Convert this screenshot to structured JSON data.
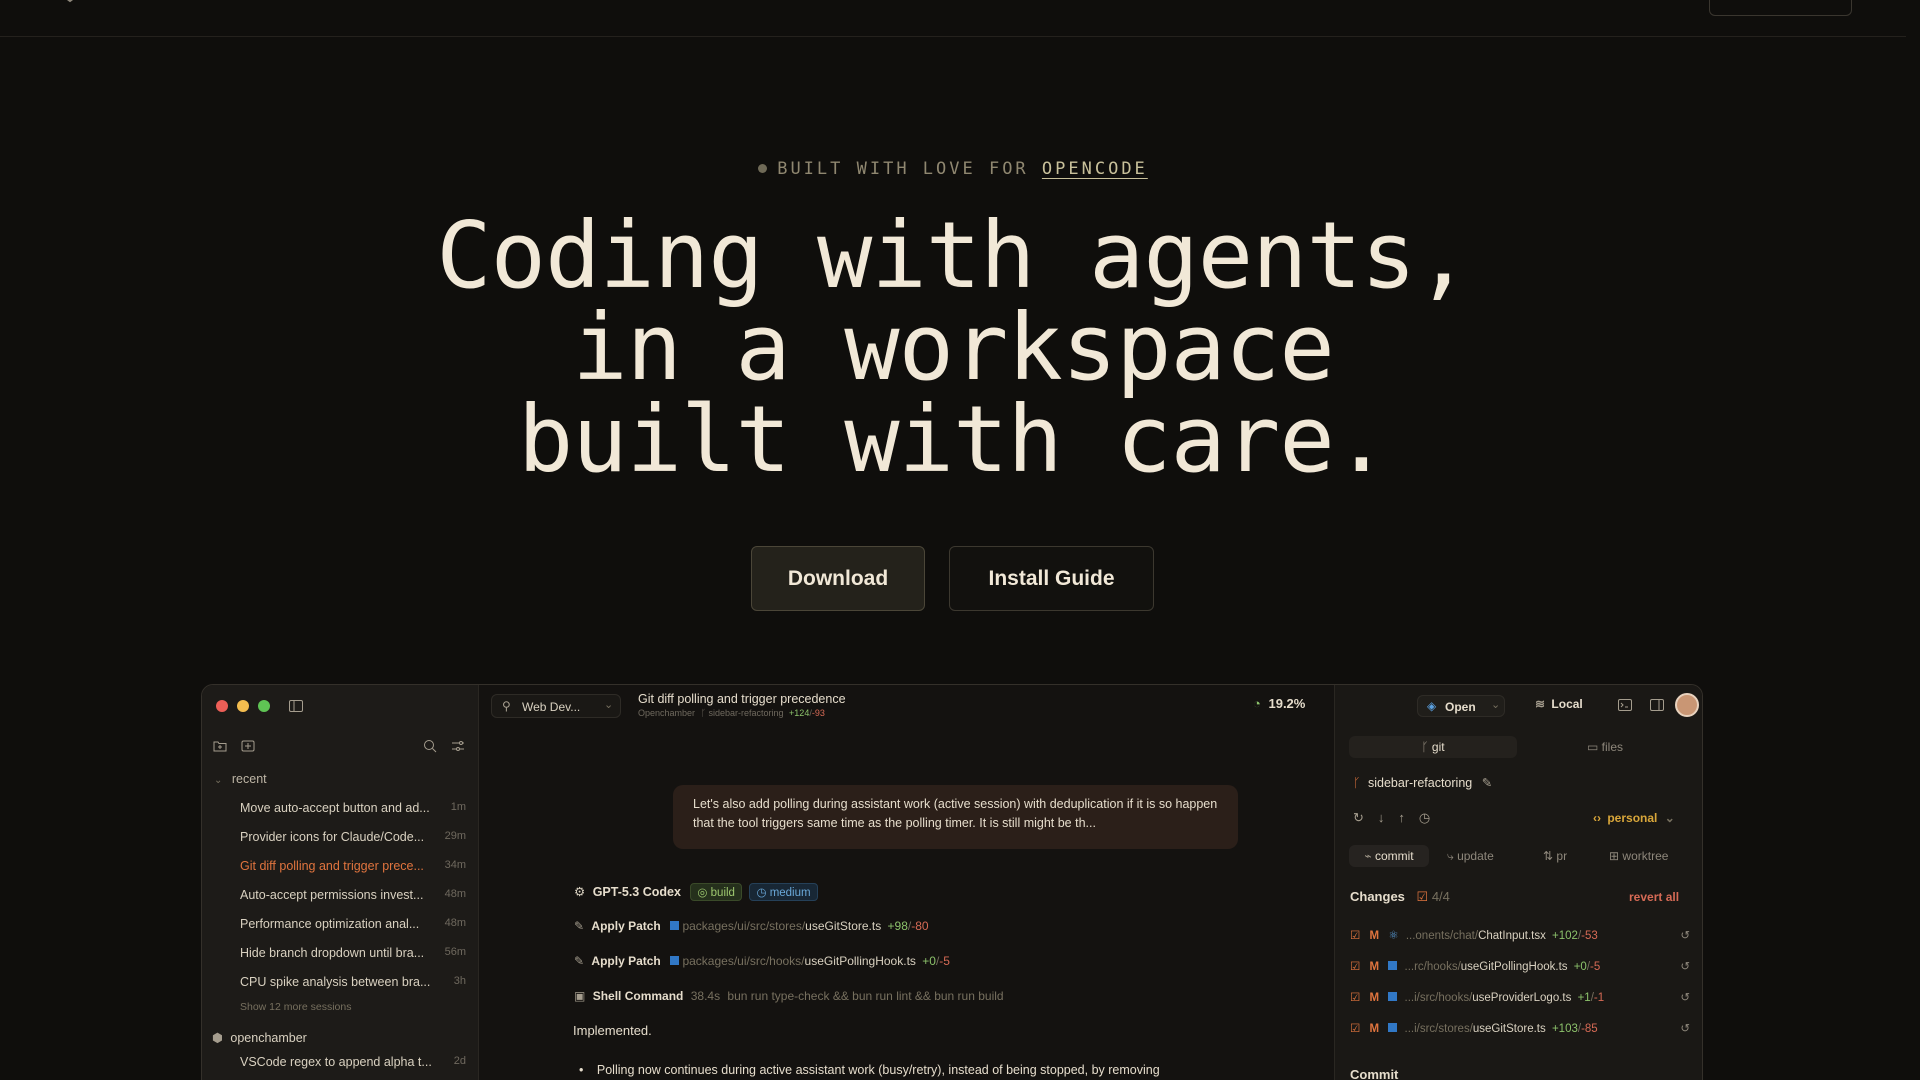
{
  "hero": {
    "eyebrow_prefix": "BUILT WITH LOVE FOR ",
    "eyebrow_link": "OPENCODE",
    "headline_line1": "Coding with agents,",
    "headline_line2": "in a workspace",
    "headline_line3": "built with care.",
    "download_label": "Download",
    "install_label": "Install Guide"
  },
  "app": {
    "sidebar": {
      "group_label": "recent",
      "sessions": [
        {
          "title": "Move auto-accept button and ad...",
          "ago": "1m"
        },
        {
          "title": "Provider icons for Claude/Code...",
          "ago": "29m"
        },
        {
          "title": "Git diff polling and trigger prece...",
          "ago": "34m"
        },
        {
          "title": "Auto-accept permissions invest...",
          "ago": "48m"
        },
        {
          "title": "Performance optimization anal...",
          "ago": "48m"
        },
        {
          "title": "Hide branch dropdown until bra...",
          "ago": "56m"
        },
        {
          "title": "CPU spike analysis between bra...",
          "ago": "3h"
        }
      ],
      "show_more": "Show 12 more sessions",
      "project_name": "openchamber",
      "project_session": {
        "title": "VSCode regex to append alpha t...",
        "ago": "2d"
      }
    },
    "header": {
      "project_selector": "Web Dev...",
      "session_title": "Git diff polling and trigger precedence",
      "session_project": "Openchamber",
      "session_branch": "sidebar-refactoring",
      "session_additions": "+124",
      "session_deletions": "-93",
      "context_percent": "19.2%"
    },
    "chat": {
      "user_message": "Let's also add polling during assistant work (active session) with deduplication if it is so happen that the tool triggers same time as the polling timer. It is still might be th...",
      "model_name": "GPT-5.3 Codex",
      "agent_badge": "build",
      "effort_badge": "medium",
      "tools": [
        {
          "name": "Apply Patch",
          "path_prefix": "packages/ui/src/stores/",
          "file": "useGitStore.ts",
          "add": "+98",
          "del": "-80"
        },
        {
          "name": "Apply Patch",
          "path_prefix": "packages/ui/src/hooks/",
          "file": "useGitPollingHook.ts",
          "add": "+0",
          "del": "-5"
        }
      ],
      "shell": {
        "name": "Shell Command",
        "duration": "38.4s",
        "command": "bun run type-check && bun run lint && bun run build"
      },
      "result": "Implemented.",
      "bullet": "Polling now continues during active assistant work (busy/retry), instead of being stopped, by removing"
    },
    "right": {
      "open_label": "Open",
      "local_label": "Local",
      "tab_git": "git",
      "tab_files": "files",
      "branch": "sidebar-refactoring",
      "identity": "personal",
      "actions": [
        "commit",
        "update",
        "pr",
        "worktree"
      ],
      "changes_label": "Changes",
      "changes_count": "4/4",
      "revert_all": "revert all",
      "files": [
        {
          "status": "M",
          "path": "...onents/chat/",
          "file": "ChatInput.tsx",
          "add": "+102",
          "del": "-53"
        },
        {
          "status": "M",
          "path": "...rc/hooks/",
          "file": "useGitPollingHook.ts",
          "add": "+0",
          "del": "-5"
        },
        {
          "status": "M",
          "path": "...i/src/hooks/",
          "file": "useProviderLogo.ts",
          "add": "+1",
          "del": "-1"
        },
        {
          "status": "M",
          "path": "...i/src/stores/",
          "file": "useGitStore.ts",
          "add": "+103",
          "del": "-85"
        }
      ],
      "commit_label": "Commit"
    }
  },
  "colors": {
    "background": "#0f0e0c",
    "text": "#f1e8d7",
    "accent_orange": "#e0743e",
    "add_green": "#8cc26b",
    "del_red": "#d66a55"
  }
}
